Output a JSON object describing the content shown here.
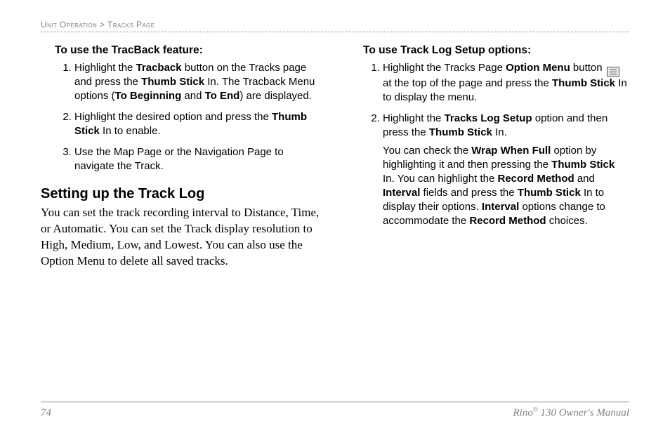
{
  "breadcrumb": {
    "part1": "Unit Operation",
    "sep": " > ",
    "part2": "Tracks Page"
  },
  "left": {
    "heading1": "To use the TracBack feature:",
    "steps": [
      {
        "pre": "Highlight the ",
        "b1": "Tracback",
        "mid1": " button on the Tracks page and press the ",
        "b2": "Thumb Stick",
        "mid2": " In. The Tracback Menu options (",
        "b3": "To Beginning",
        "mid3": " and ",
        "b4": "To End",
        "post": ") are displayed."
      },
      {
        "pre": "Highlight the desired option and press the ",
        "b1": "Thumb Stick",
        "post": " In to enable."
      },
      {
        "pre": "Use the Map Page or the Navigation Page to navigate the Track."
      }
    ],
    "section_title": "Setting up the Track Log",
    "section_para": "You can set the track recording interval to Distance, Time, or Automatic. You can set the Track display resolution to High, Medium, Low, and Lowest. You can also use the Option Menu to delete all saved tracks."
  },
  "right": {
    "heading1": "To use Track Log Setup options:",
    "steps": [
      {
        "pre": "Highlight the Tracks Page ",
        "b1": "Option Menu",
        "mid1": " button ",
        "icon": true,
        "mid2": " at the top of the page and press the ",
        "b2": "Thumb Stick",
        "post": " In to display the menu."
      },
      {
        "pre": "Highlight the ",
        "b1": "Tracks Log Setup",
        "mid1": " option and then press the ",
        "b2": "Thumb Stick",
        "post": " In.",
        "continuation": {
          "pre": "You can check the ",
          "b1": "Wrap When Full",
          "mid1": " option by highlighting it and then pressing the ",
          "b2": "Thumb Stick",
          "mid2": " In. You can highlight the ",
          "b3": "Record Method",
          "mid3": " and ",
          "b4": "Interval",
          "mid4": " fields and press the ",
          "b5": "Thumb Stick",
          "mid5": " In to display their options. ",
          "b6": "Interval",
          "mid6": " options change to accommodate the ",
          "b7": "Record Method",
          "post": " choices."
        }
      }
    ]
  },
  "footer": {
    "page": "74",
    "product_pre": "Rino",
    "product_sup": "®",
    "product_post": " 130 Owner's Manual"
  }
}
